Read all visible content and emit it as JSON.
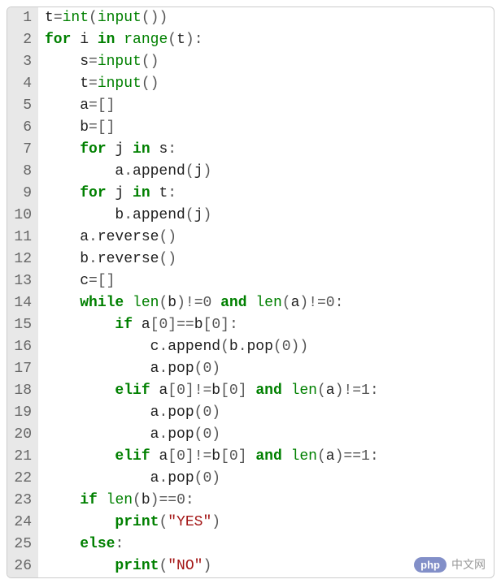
{
  "lines": [
    {
      "n": "1",
      "tokens": [
        [
          "ident",
          "t"
        ],
        [
          "operator",
          "="
        ],
        [
          "builtin",
          "int"
        ],
        [
          "punct",
          "("
        ],
        [
          "builtin",
          "input"
        ],
        [
          "punct",
          "("
        ],
        [
          "punct",
          ")"
        ],
        [
          "punct",
          ")"
        ]
      ]
    },
    {
      "n": "2",
      "tokens": [
        [
          "keyword",
          "for"
        ],
        [
          "ident",
          " i "
        ],
        [
          "keyword",
          "in"
        ],
        [
          "ident",
          " "
        ],
        [
          "builtin",
          "range"
        ],
        [
          "punct",
          "("
        ],
        [
          "ident",
          "t"
        ],
        [
          "punct",
          ")"
        ],
        [
          "punct",
          ":"
        ]
      ]
    },
    {
      "n": "3",
      "tokens": [
        [
          "ident",
          "    s"
        ],
        [
          "operator",
          "="
        ],
        [
          "builtin",
          "input"
        ],
        [
          "punct",
          "("
        ],
        [
          "punct",
          ")"
        ]
      ]
    },
    {
      "n": "4",
      "tokens": [
        [
          "ident",
          "    t"
        ],
        [
          "operator",
          "="
        ],
        [
          "builtin",
          "input"
        ],
        [
          "punct",
          "("
        ],
        [
          "punct",
          ")"
        ]
      ]
    },
    {
      "n": "5",
      "tokens": [
        [
          "ident",
          "    a"
        ],
        [
          "operator",
          "="
        ],
        [
          "punct",
          "["
        ],
        [
          "punct",
          "]"
        ]
      ]
    },
    {
      "n": "6",
      "tokens": [
        [
          "ident",
          "    b"
        ],
        [
          "operator",
          "="
        ],
        [
          "punct",
          "["
        ],
        [
          "punct",
          "]"
        ]
      ]
    },
    {
      "n": "7",
      "tokens": [
        [
          "ident",
          "    "
        ],
        [
          "keyword",
          "for"
        ],
        [
          "ident",
          " j "
        ],
        [
          "keyword",
          "in"
        ],
        [
          "ident",
          " s"
        ],
        [
          "punct",
          ":"
        ]
      ]
    },
    {
      "n": "8",
      "tokens": [
        [
          "ident",
          "        a"
        ],
        [
          "operator",
          "."
        ],
        [
          "ident",
          "append"
        ],
        [
          "punct",
          "("
        ],
        [
          "ident",
          "j"
        ],
        [
          "punct",
          ")"
        ]
      ]
    },
    {
      "n": "9",
      "tokens": [
        [
          "ident",
          "    "
        ],
        [
          "keyword",
          "for"
        ],
        [
          "ident",
          " j "
        ],
        [
          "keyword",
          "in"
        ],
        [
          "ident",
          " t"
        ],
        [
          "punct",
          ":"
        ]
      ]
    },
    {
      "n": "10",
      "tokens": [
        [
          "ident",
          "        b"
        ],
        [
          "operator",
          "."
        ],
        [
          "ident",
          "append"
        ],
        [
          "punct",
          "("
        ],
        [
          "ident",
          "j"
        ],
        [
          "punct",
          ")"
        ]
      ]
    },
    {
      "n": "11",
      "tokens": [
        [
          "ident",
          "    a"
        ],
        [
          "operator",
          "."
        ],
        [
          "ident",
          "reverse"
        ],
        [
          "punct",
          "("
        ],
        [
          "punct",
          ")"
        ]
      ]
    },
    {
      "n": "12",
      "tokens": [
        [
          "ident",
          "    b"
        ],
        [
          "operator",
          "."
        ],
        [
          "ident",
          "reverse"
        ],
        [
          "punct",
          "("
        ],
        [
          "punct",
          ")"
        ]
      ]
    },
    {
      "n": "13",
      "tokens": [
        [
          "ident",
          "    c"
        ],
        [
          "operator",
          "="
        ],
        [
          "punct",
          "["
        ],
        [
          "punct",
          "]"
        ]
      ]
    },
    {
      "n": "14",
      "tokens": [
        [
          "ident",
          "    "
        ],
        [
          "keyword",
          "while"
        ],
        [
          "ident",
          " "
        ],
        [
          "builtin",
          "len"
        ],
        [
          "punct",
          "("
        ],
        [
          "ident",
          "b"
        ],
        [
          "punct",
          ")"
        ],
        [
          "operator",
          "!="
        ],
        [
          "number",
          "0"
        ],
        [
          "ident",
          " "
        ],
        [
          "keyword",
          "and"
        ],
        [
          "ident",
          " "
        ],
        [
          "builtin",
          "len"
        ],
        [
          "punct",
          "("
        ],
        [
          "ident",
          "a"
        ],
        [
          "punct",
          ")"
        ],
        [
          "operator",
          "!="
        ],
        [
          "number",
          "0"
        ],
        [
          "punct",
          ":"
        ]
      ]
    },
    {
      "n": "15",
      "tokens": [
        [
          "ident",
          "        "
        ],
        [
          "keyword",
          "if"
        ],
        [
          "ident",
          " a"
        ],
        [
          "punct",
          "["
        ],
        [
          "number",
          "0"
        ],
        [
          "punct",
          "]"
        ],
        [
          "operator",
          "=="
        ],
        [
          "ident",
          "b"
        ],
        [
          "punct",
          "["
        ],
        [
          "number",
          "0"
        ],
        [
          "punct",
          "]"
        ],
        [
          "punct",
          ":"
        ]
      ]
    },
    {
      "n": "16",
      "tokens": [
        [
          "ident",
          "            c"
        ],
        [
          "operator",
          "."
        ],
        [
          "ident",
          "append"
        ],
        [
          "punct",
          "("
        ],
        [
          "ident",
          "b"
        ],
        [
          "operator",
          "."
        ],
        [
          "ident",
          "pop"
        ],
        [
          "punct",
          "("
        ],
        [
          "number",
          "0"
        ],
        [
          "punct",
          ")"
        ],
        [
          "punct",
          ")"
        ]
      ]
    },
    {
      "n": "17",
      "tokens": [
        [
          "ident",
          "            a"
        ],
        [
          "operator",
          "."
        ],
        [
          "ident",
          "pop"
        ],
        [
          "punct",
          "("
        ],
        [
          "number",
          "0"
        ],
        [
          "punct",
          ")"
        ]
      ]
    },
    {
      "n": "18",
      "tokens": [
        [
          "ident",
          "        "
        ],
        [
          "keyword",
          "elif"
        ],
        [
          "ident",
          " a"
        ],
        [
          "punct",
          "["
        ],
        [
          "number",
          "0"
        ],
        [
          "punct",
          "]"
        ],
        [
          "operator",
          "!="
        ],
        [
          "ident",
          "b"
        ],
        [
          "punct",
          "["
        ],
        [
          "number",
          "0"
        ],
        [
          "punct",
          "]"
        ],
        [
          "ident",
          " "
        ],
        [
          "keyword",
          "and"
        ],
        [
          "ident",
          " "
        ],
        [
          "builtin",
          "len"
        ],
        [
          "punct",
          "("
        ],
        [
          "ident",
          "a"
        ],
        [
          "punct",
          ")"
        ],
        [
          "operator",
          "!="
        ],
        [
          "number",
          "1"
        ],
        [
          "punct",
          ":"
        ]
      ]
    },
    {
      "n": "19",
      "tokens": [
        [
          "ident",
          "            a"
        ],
        [
          "operator",
          "."
        ],
        [
          "ident",
          "pop"
        ],
        [
          "punct",
          "("
        ],
        [
          "number",
          "0"
        ],
        [
          "punct",
          ")"
        ]
      ]
    },
    {
      "n": "20",
      "tokens": [
        [
          "ident",
          "            a"
        ],
        [
          "operator",
          "."
        ],
        [
          "ident",
          "pop"
        ],
        [
          "punct",
          "("
        ],
        [
          "number",
          "0"
        ],
        [
          "punct",
          ")"
        ]
      ]
    },
    {
      "n": "21",
      "tokens": [
        [
          "ident",
          "        "
        ],
        [
          "keyword",
          "elif"
        ],
        [
          "ident",
          " a"
        ],
        [
          "punct",
          "["
        ],
        [
          "number",
          "0"
        ],
        [
          "punct",
          "]"
        ],
        [
          "operator",
          "!="
        ],
        [
          "ident",
          "b"
        ],
        [
          "punct",
          "["
        ],
        [
          "number",
          "0"
        ],
        [
          "punct",
          "]"
        ],
        [
          "ident",
          " "
        ],
        [
          "keyword",
          "and"
        ],
        [
          "ident",
          " "
        ],
        [
          "builtin",
          "len"
        ],
        [
          "punct",
          "("
        ],
        [
          "ident",
          "a"
        ],
        [
          "punct",
          ")"
        ],
        [
          "operator",
          "=="
        ],
        [
          "number",
          "1"
        ],
        [
          "punct",
          ":"
        ]
      ]
    },
    {
      "n": "22",
      "tokens": [
        [
          "ident",
          "            a"
        ],
        [
          "operator",
          "."
        ],
        [
          "ident",
          "pop"
        ],
        [
          "punct",
          "("
        ],
        [
          "number",
          "0"
        ],
        [
          "punct",
          ")"
        ]
      ]
    },
    {
      "n": "23",
      "tokens": [
        [
          "ident",
          "    "
        ],
        [
          "keyword",
          "if"
        ],
        [
          "ident",
          " "
        ],
        [
          "builtin",
          "len"
        ],
        [
          "punct",
          "("
        ],
        [
          "ident",
          "b"
        ],
        [
          "punct",
          ")"
        ],
        [
          "operator",
          "=="
        ],
        [
          "number",
          "0"
        ],
        [
          "punct",
          ":"
        ]
      ]
    },
    {
      "n": "24",
      "tokens": [
        [
          "ident",
          "        "
        ],
        [
          "keyword",
          "print"
        ],
        [
          "punct",
          "("
        ],
        [
          "string",
          "\"YES\""
        ],
        [
          "punct",
          ")"
        ]
      ]
    },
    {
      "n": "25",
      "tokens": [
        [
          "ident",
          "    "
        ],
        [
          "keyword",
          "else"
        ],
        [
          "punct",
          ":"
        ]
      ]
    },
    {
      "n": "26",
      "tokens": [
        [
          "ident",
          "        "
        ],
        [
          "keyword",
          "print"
        ],
        [
          "punct",
          "("
        ],
        [
          "string",
          "\"NO\""
        ],
        [
          "punct",
          ")"
        ]
      ]
    }
  ],
  "watermark": {
    "badge": "php",
    "text": "中文网"
  }
}
